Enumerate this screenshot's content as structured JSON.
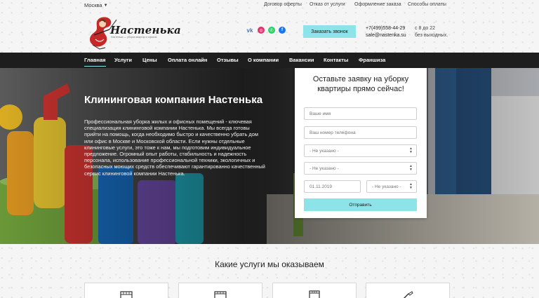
{
  "topbar": {
    "city": "Москва",
    "links": [
      "Договор оферты",
      "Отказ от услуги",
      "Оформление заказа",
      "Способы оплаты"
    ]
  },
  "logo": {
    "name": "Настенька",
    "tagline": "Настенька — уборка квартир и офисов"
  },
  "header": {
    "call_button": "Заказать звонок",
    "phone": "+7(499)558-44-29",
    "email": "sale@nastenka.su",
    "hours_line1": "с 8 до 22",
    "hours_line2": "без выходных."
  },
  "social": [
    "vk-icon",
    "instagram-icon",
    "whatsapp-icon",
    "facebook-icon"
  ],
  "nav": {
    "items": [
      "Главная",
      "Услуги",
      "Цены",
      "Оплата онлайн",
      "Отзывы",
      "О компании",
      "Вакансии",
      "Контакты",
      "Франшиза"
    ],
    "active": "Главная"
  },
  "hero": {
    "title": "Клининговая компания Настенька",
    "text": "Профессиональная уборка жилых и офисных помещений - ключевая специализация клининговой компании Настенька. Мы всегда готовы прийти на помощь, когда необходимо быстро и качественно убрать дом или офис в Москве и Московской области. Если нужны отдельные клининговые услуги, это тоже к нам, мы подготовим индивидуальное предложение. Огромный опыт работы, стабильность и надежность персонала, использование профессиональной техники, экологичных и безопасных моющих средств обеспечивают гарантированно качественный сервис клининговой компании Настенька."
  },
  "form": {
    "title": "Оставьте заявку на уборку квартиры прямо сейчас!",
    "name_placeholder": "Ваше имя",
    "phone_placeholder": "Ваш номер телефона",
    "select1": "- Не указано -",
    "select2": "- Не указано -",
    "date": "01.11.2019",
    "select3": "- Не указано -",
    "submit": "Отправить"
  },
  "services": {
    "title": "Какие услуги мы оказываем",
    "cards": [
      "sofa-icon",
      "wardrobe-icon",
      "window-icon",
      "cleaning-icon"
    ]
  },
  "colors": {
    "accent": "#8ce4e8",
    "nav_bg": "#1e1e1e"
  }
}
